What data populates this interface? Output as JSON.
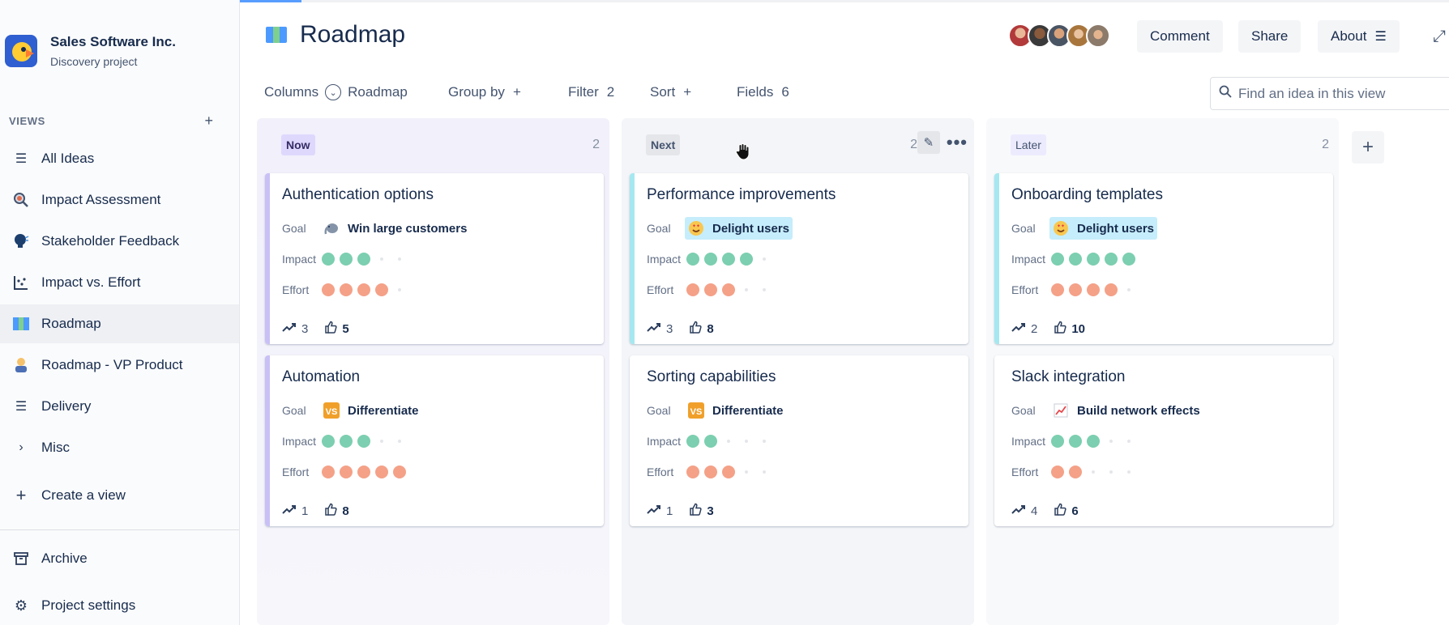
{
  "project": {
    "name": "Sales Software Inc.",
    "subtitle": "Discovery project"
  },
  "sidebar": {
    "views_label": "VIEWS",
    "items": [
      {
        "label": "All Ideas",
        "icon": "list-icon"
      },
      {
        "label": "Impact Assessment",
        "icon": "magnifier-icon"
      },
      {
        "label": "Stakeholder Feedback",
        "icon": "speaker-icon"
      },
      {
        "label": "Impact vs. Effort",
        "icon": "scatter-icon"
      },
      {
        "label": "Roadmap",
        "icon": "map-icon",
        "active": true
      },
      {
        "label": "Roadmap - VP Product",
        "icon": "person-icon"
      },
      {
        "label": "Delivery",
        "icon": "list-icon"
      },
      {
        "label": "Misc",
        "icon": "chevron-right-icon"
      },
      {
        "label": "Create a view",
        "icon": "plus-icon"
      }
    ],
    "archive": "Archive",
    "settings": "Project settings"
  },
  "header": {
    "title": "Roadmap",
    "comment": "Comment",
    "share": "Share",
    "about": "About"
  },
  "toolbar": {
    "columns_label": "Columns",
    "columns_value": "Roadmap",
    "group_by": "Group by",
    "filter": "Filter",
    "filter_count": "2",
    "sort": "Sort",
    "fields": "Fields",
    "fields_count": "6",
    "search_placeholder": "Find an idea in this view"
  },
  "labels": {
    "goal": "Goal",
    "impact": "Impact",
    "effort": "Effort"
  },
  "columns": [
    {
      "name": "Now",
      "count": "2",
      "cards": [
        {
          "title": "Authentication options",
          "goal": "Win large customers",
          "goal_icon": "elephant-icon",
          "impact": 3,
          "effort": 4,
          "trend": "3",
          "likes": "5"
        },
        {
          "title": "Automation",
          "goal": "Differentiate",
          "goal_icon": "vs-icon",
          "impact": 3,
          "effort": 5,
          "trend": "1",
          "likes": "8"
        }
      ]
    },
    {
      "name": "Next",
      "count": "2",
      "cards": [
        {
          "title": "Performance improvements",
          "goal": "Delight users",
          "goal_icon": "heart-eyes-icon",
          "impact": 4,
          "effort": 3,
          "trend": "3",
          "likes": "8"
        },
        {
          "title": "Sorting capabilities",
          "goal": "Differentiate",
          "goal_icon": "vs-icon",
          "impact": 2,
          "effort": 3,
          "trend": "1",
          "likes": "3"
        }
      ]
    },
    {
      "name": "Later",
      "count": "2",
      "cards": [
        {
          "title": "Onboarding templates",
          "goal": "Delight users",
          "goal_icon": "heart-eyes-icon",
          "impact": 5,
          "effort": 4,
          "trend": "2",
          "likes": "10"
        },
        {
          "title": "Slack integration",
          "goal": "Build network effects",
          "goal_icon": "chart-up-icon",
          "impact": 3,
          "effort": 2,
          "trend": "4",
          "likes": "6"
        }
      ]
    }
  ],
  "colors": {
    "impact": "#7ccfb0",
    "effort": "#f4a188",
    "accent": "#579dff"
  }
}
